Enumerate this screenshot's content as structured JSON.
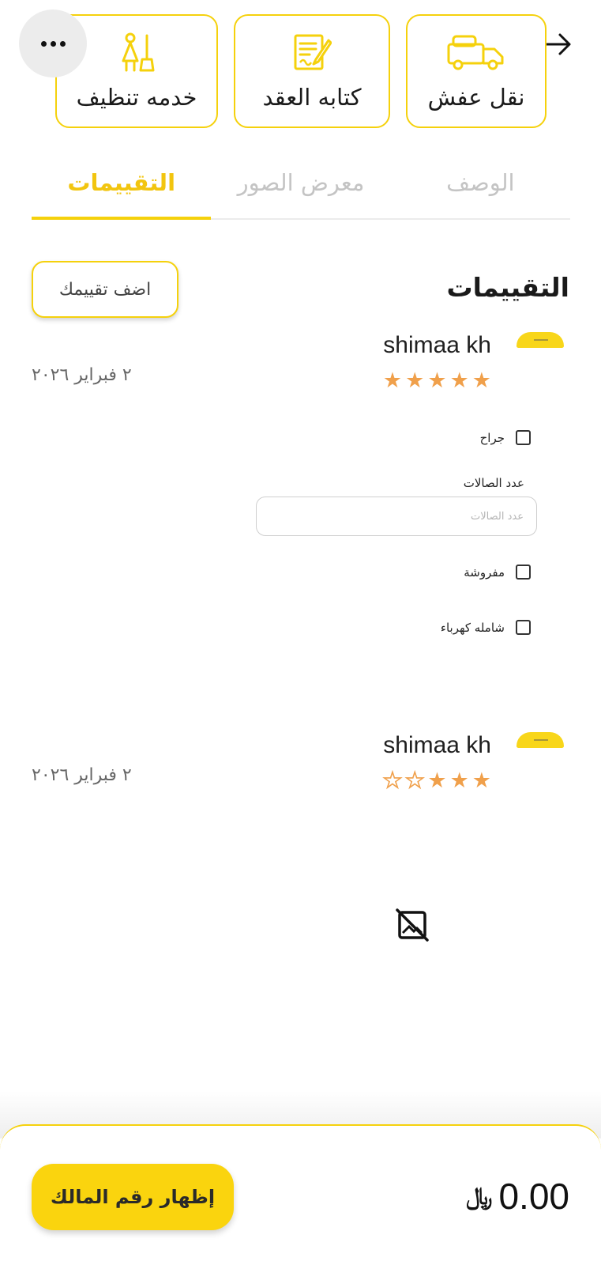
{
  "services": [
    {
      "label": "نقل عفش",
      "icon": "truck-icon"
    },
    {
      "label": "كتابه العقد",
      "icon": "contract-icon"
    },
    {
      "label": "خدمه تنظيف",
      "icon": "cleaning-icon"
    }
  ],
  "tabs": [
    {
      "label": "الوصف",
      "active": false
    },
    {
      "label": "معرض الصور",
      "active": false
    },
    {
      "label": "التقييمات",
      "active": true
    }
  ],
  "reviews_section": {
    "title": "التقييمات",
    "add_review_label": "اضف تقييمك"
  },
  "reviews": [
    {
      "name": "shimaa kh",
      "date": "٢ فبراير ٢٠٢٦",
      "rating": 5,
      "max_rating": 5,
      "fields": {
        "garage_label": "جراح",
        "halls_label": "عدد الصالات",
        "halls_placeholder": "عدد الصالات",
        "halls_value": "",
        "furnished_label": "مفروشة",
        "electricity_label": "شامله كهرباء"
      }
    },
    {
      "name": "shimaa kh",
      "date": "٢ فبراير ٢٠٢٦",
      "rating": 3,
      "max_rating": 5
    }
  ],
  "footer": {
    "price": "0.00",
    "currency_symbol": "﷼",
    "show_phone_label": "إظهار رقم المالك"
  },
  "colors": {
    "accent": "#f5d10c",
    "star": "#f0a04b",
    "tab_active": "#f2c50f",
    "tab_inactive": "#c4c4c4"
  }
}
